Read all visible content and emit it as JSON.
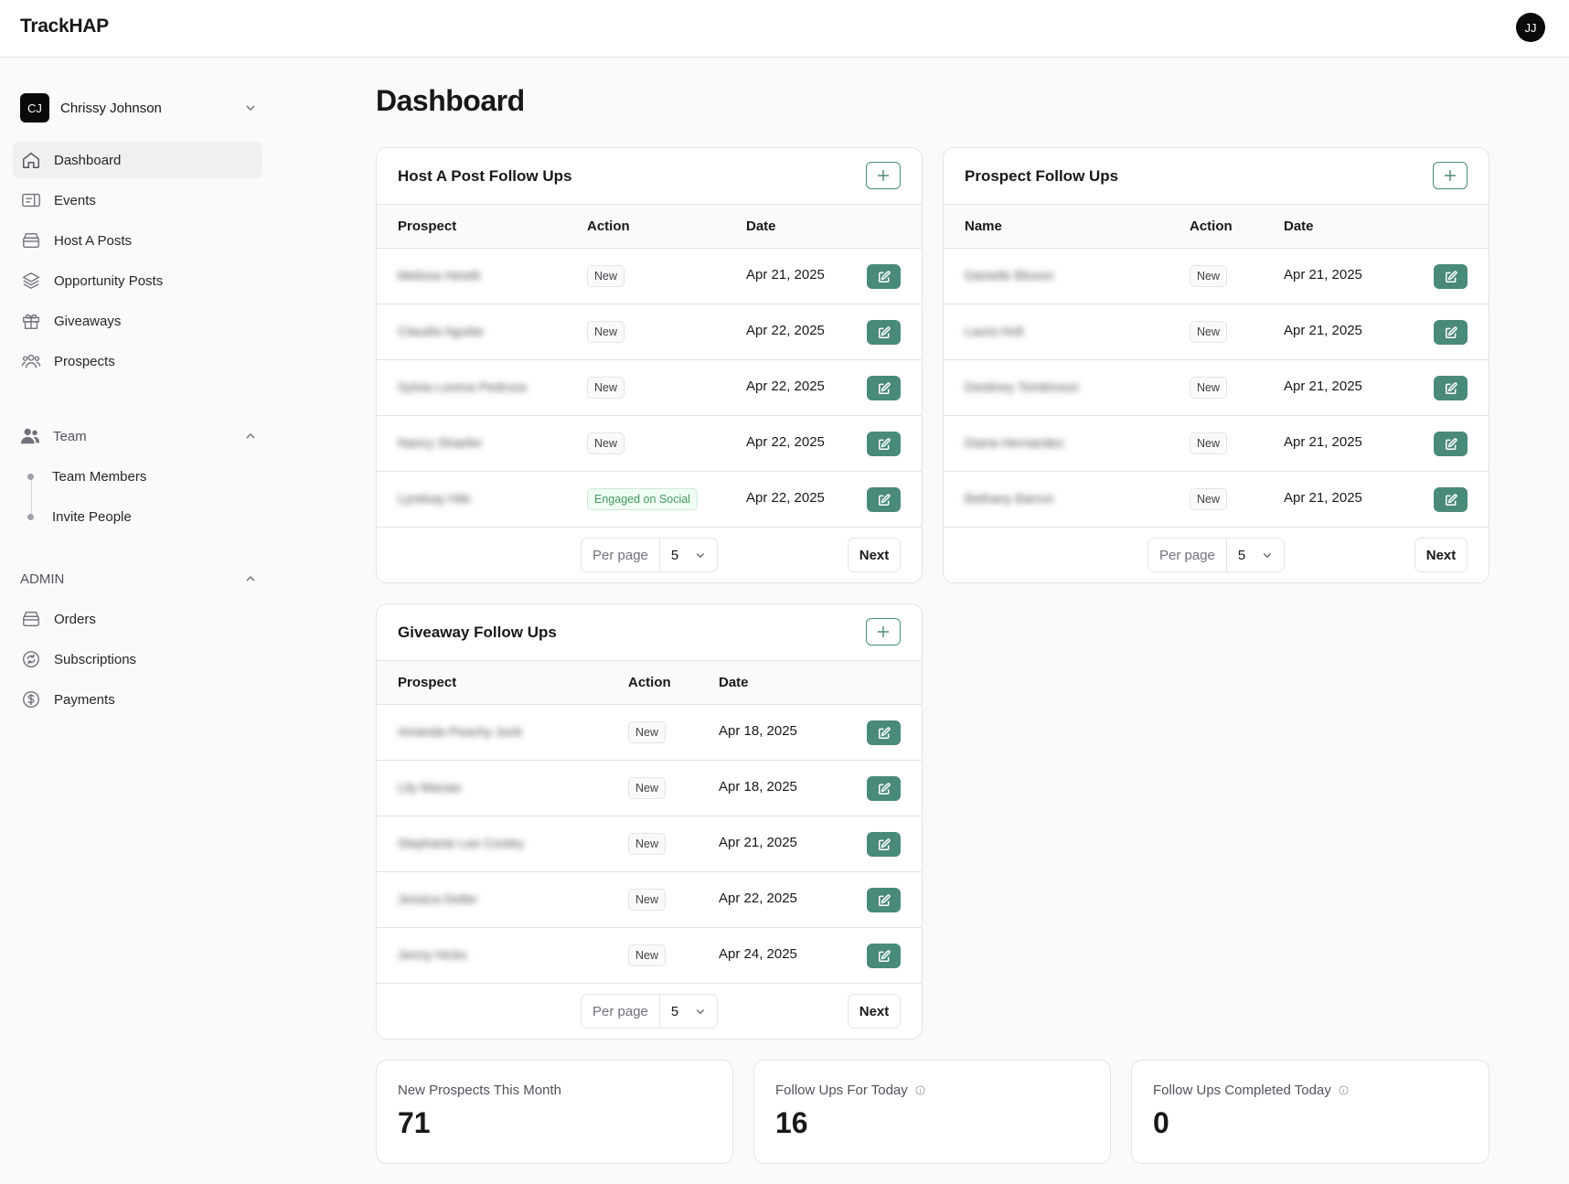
{
  "app": {
    "brand": "TrackHAP",
    "user_initials": "JJ"
  },
  "sidebar": {
    "account": {
      "initials": "CJ",
      "name": "Chrissy Johnson"
    },
    "items": [
      {
        "label": "Dashboard",
        "icon": "home-icon",
        "active": true
      },
      {
        "label": "Events",
        "icon": "ticket-icon"
      },
      {
        "label": "Host A Posts",
        "icon": "archive-icon"
      },
      {
        "label": "Opportunity Posts",
        "icon": "layers-icon"
      },
      {
        "label": "Giveaways",
        "icon": "gift-icon"
      },
      {
        "label": "Prospects",
        "icon": "users-group-icon"
      }
    ],
    "team": {
      "label": "Team",
      "icon": "team-icon",
      "children": [
        "Team Members",
        "Invite People"
      ]
    },
    "admin": {
      "label": "ADMIN",
      "items": [
        {
          "label": "Orders",
          "icon": "archive-icon"
        },
        {
          "label": "Subscriptions",
          "icon": "refresh-icon"
        },
        {
          "label": "Payments",
          "icon": "dollar-icon"
        }
      ]
    }
  },
  "main": {
    "title": "Dashboard",
    "host_post": {
      "title": "Host A Post Follow Ups",
      "columns": [
        "Prospect",
        "Action",
        "Date"
      ],
      "rows": [
        {
          "name": "Melissa Hewitt",
          "action": "New",
          "date": "Apr 21, 2025"
        },
        {
          "name": "Claudia Aguilar",
          "action": "New",
          "date": "Apr 22, 2025"
        },
        {
          "name": "Sylvia Lorena Pedroza",
          "action": "New",
          "date": "Apr 22, 2025"
        },
        {
          "name": "Nancy Shaefer",
          "action": "New",
          "date": "Apr 22, 2025"
        },
        {
          "name": "Lyndsay Hile",
          "action": "Engaged on Social",
          "date": "Apr 22, 2025"
        }
      ],
      "per_page_label": "Per page",
      "per_page": "5",
      "next": "Next"
    },
    "prospect": {
      "title": "Prospect Follow Ups",
      "columns": [
        "Name",
        "Action",
        "Date"
      ],
      "rows": [
        {
          "name": "Danielle Bloxon",
          "action": "New",
          "date": "Apr 21, 2025"
        },
        {
          "name": "Laura Holt",
          "action": "New",
          "date": "Apr 21, 2025"
        },
        {
          "name": "Destiney Tomkinson",
          "action": "New",
          "date": "Apr 21, 2025"
        },
        {
          "name": "Diana Hernandez",
          "action": "New",
          "date": "Apr 21, 2025"
        },
        {
          "name": "Bethany Barron",
          "action": "New",
          "date": "Apr 21, 2025"
        }
      ],
      "per_page_label": "Per page",
      "per_page": "5",
      "next": "Next"
    },
    "giveaway": {
      "title": "Giveaway Follow Ups",
      "columns": [
        "Prospect",
        "Action",
        "Date"
      ],
      "rows": [
        {
          "name": "Amanda Peachy Junk",
          "action": "New",
          "date": "Apr 18, 2025"
        },
        {
          "name": "Lily Macias",
          "action": "New",
          "date": "Apr 18, 2025"
        },
        {
          "name": "Stephanie Lee Conley",
          "action": "New",
          "date": "Apr 21, 2025"
        },
        {
          "name": "Jessica Deller",
          "action": "New",
          "date": "Apr 22, 2025"
        },
        {
          "name": "Jenny Hicks",
          "action": "New",
          "date": "Apr 24, 2025"
        }
      ],
      "per_page_label": "Per page",
      "per_page": "5",
      "next": "Next"
    },
    "stats": [
      {
        "label": "New Prospects This Month",
        "value": "71",
        "info": false
      },
      {
        "label": "Follow Ups For Today",
        "value": "16",
        "info": true
      },
      {
        "label": "Follow Ups Completed Today",
        "value": "0",
        "info": true
      }
    ]
  },
  "colors": {
    "accent": "#4a8a7b",
    "social_badge": "#3f9a5c"
  }
}
